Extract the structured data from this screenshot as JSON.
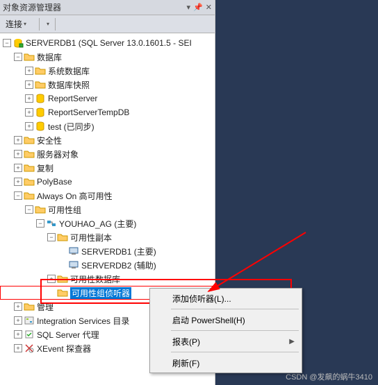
{
  "titlebar": {
    "title": "对象资源管理器"
  },
  "toolbar": {
    "connect": "连接"
  },
  "tree": {
    "server": "SERVERDB1 (SQL Server 13.0.1601.5 - SEI",
    "databases": "数据库",
    "sysdb": "系统数据库",
    "snapshot": "数据库快照",
    "reportserver": "ReportServer",
    "reportservertmp": "ReportServerTempDB",
    "test": "test (已同步)",
    "security": "安全性",
    "serverobjects": "服务器对象",
    "replication": "复制",
    "polybase": "PolyBase",
    "alwayson": "Always On 高可用性",
    "ag_group": "可用性组",
    "ag_name": "YOUHAO_AG (主要)",
    "replicas": "可用性副本",
    "replica1": "SERVERDB1 (主要)",
    "replica2": "SERVERDB2 (辅助)",
    "ag_databases": "可用性数据库",
    "ag_listeners": "可用性组侦听器",
    "management": "管理",
    "integration": "Integration Services 目录",
    "sqlagent": "SQL Server 代理",
    "xevent": "XEvent 探查器"
  },
  "menu": {
    "add_listener": "添加侦听器(L)...",
    "powershell": "启动 PowerShell(H)",
    "reports": "报表(P)",
    "refresh": "刷新(F)"
  },
  "watermark": "CSDN @发飙的蜗牛3410"
}
